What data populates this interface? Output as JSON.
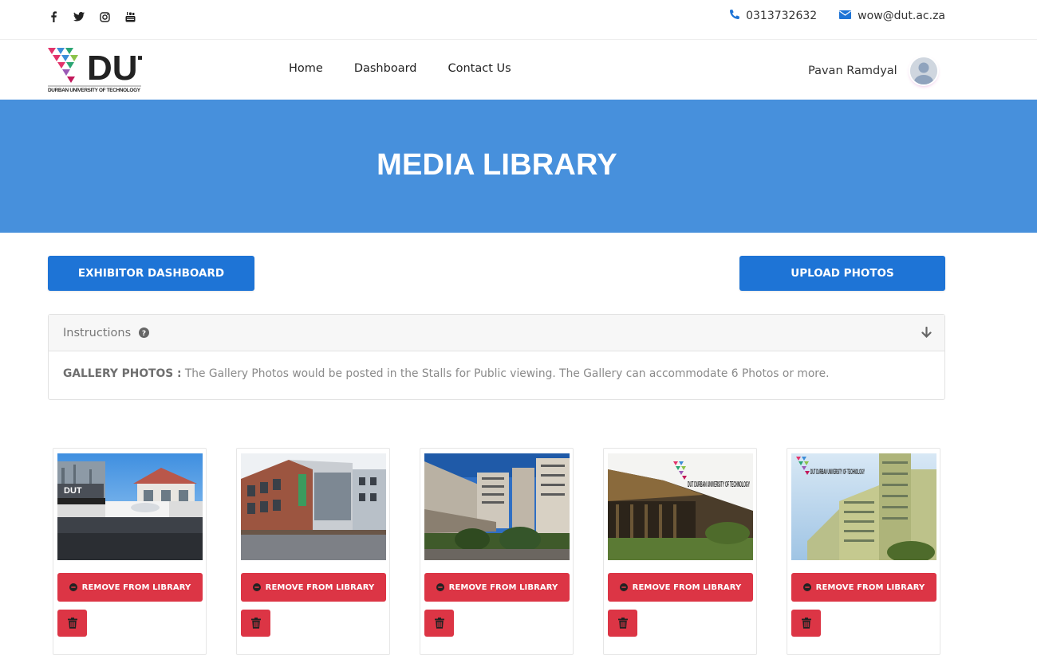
{
  "topbar": {
    "social_icons": [
      "facebook-icon",
      "twitter-icon",
      "instagram-icon",
      "youtube-icon"
    ],
    "phone": "0313732632",
    "email": "wow@dut.ac.za"
  },
  "header": {
    "logo_text": "DUT",
    "logo_subtext": "DURBAN UNIVERSITY OF TECHNOLOGY",
    "nav": [
      "Home",
      "Dashboard",
      "Contact Us"
    ],
    "user_name": "Pavan Ramdyal"
  },
  "banner": {
    "title": "MEDIA LIBRARY"
  },
  "actions": {
    "exhibitor_dashboard": "EXHIBITOR DASHBOARD",
    "upload_photos": "UPLOAD PHOTOS"
  },
  "instructions": {
    "title": "Instructions",
    "label": "GALLERY PHOTOS :",
    "text": " The Gallery Photos would be posted in the Stalls for Public viewing. The Gallery can accommodate 6 Photos or more."
  },
  "gallery": {
    "remove_label": "REMOVE FROM LIBRARY",
    "photo_overlay_text": [
      "DUT",
      "DUT DURBAN UNIVERSITY OF TECHNOLOGY",
      "DUT DURBAN UNIVERSITY OF TECHNOLOGY"
    ]
  },
  "colors": {
    "banner": "#4790dc",
    "primary_button": "#1e74d6",
    "danger_button": "#dc3545"
  }
}
